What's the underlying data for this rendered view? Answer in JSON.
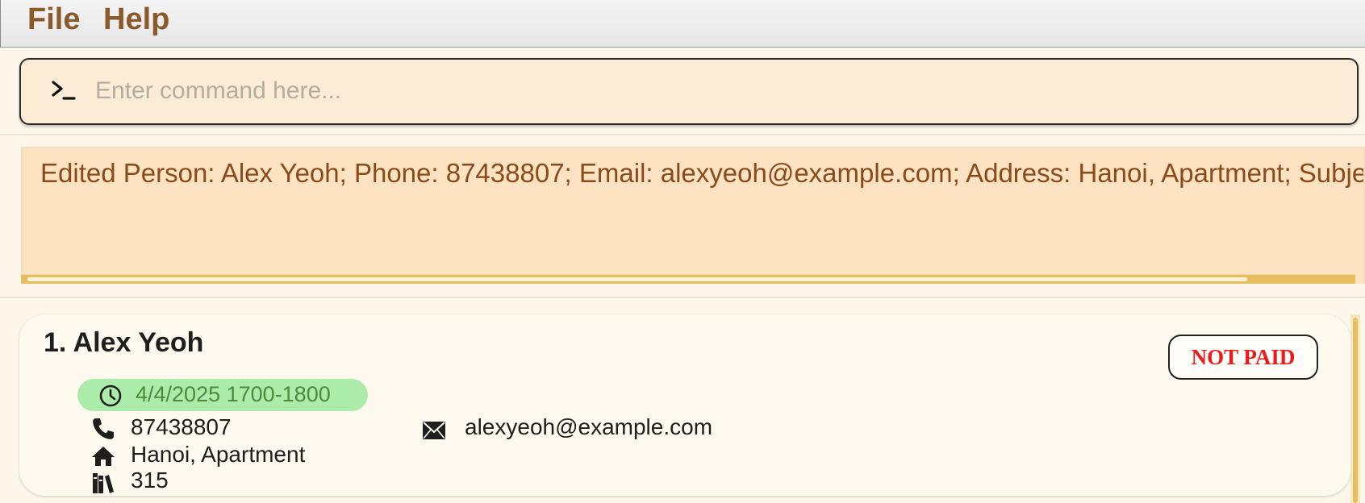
{
  "menu": {
    "file_label": "File",
    "help_label": "Help"
  },
  "command": {
    "prompt_icon": "terminal-prompt-icon",
    "placeholder": "Enter command here...",
    "value": ""
  },
  "result": {
    "text": "Edited Person: Alex Yeoh; Phone: 87438807; Email: alexyeoh@example.com; Address: Hanoi, Apartment; Subject"
  },
  "persons": [
    {
      "name": "1. Alex Yeoh",
      "session": "4/4/2025 1700-1800",
      "phone": "87438807",
      "email": "alexyeoh@example.com",
      "address": "Hanoi, Apartment",
      "subject": "315",
      "payment_status": "NOT PAID"
    }
  ],
  "colors": {
    "menu_text": "#8b5a2b",
    "result_text": "#8b4a1b",
    "session_bg": "#acecab",
    "not_paid": "#f01919",
    "accent_scroll": "#e6be62"
  },
  "icons": {
    "session": "clock-icon",
    "phone": "phone-icon",
    "email": "envelope-icon",
    "address": "home-icon",
    "subject": "books-icon"
  }
}
